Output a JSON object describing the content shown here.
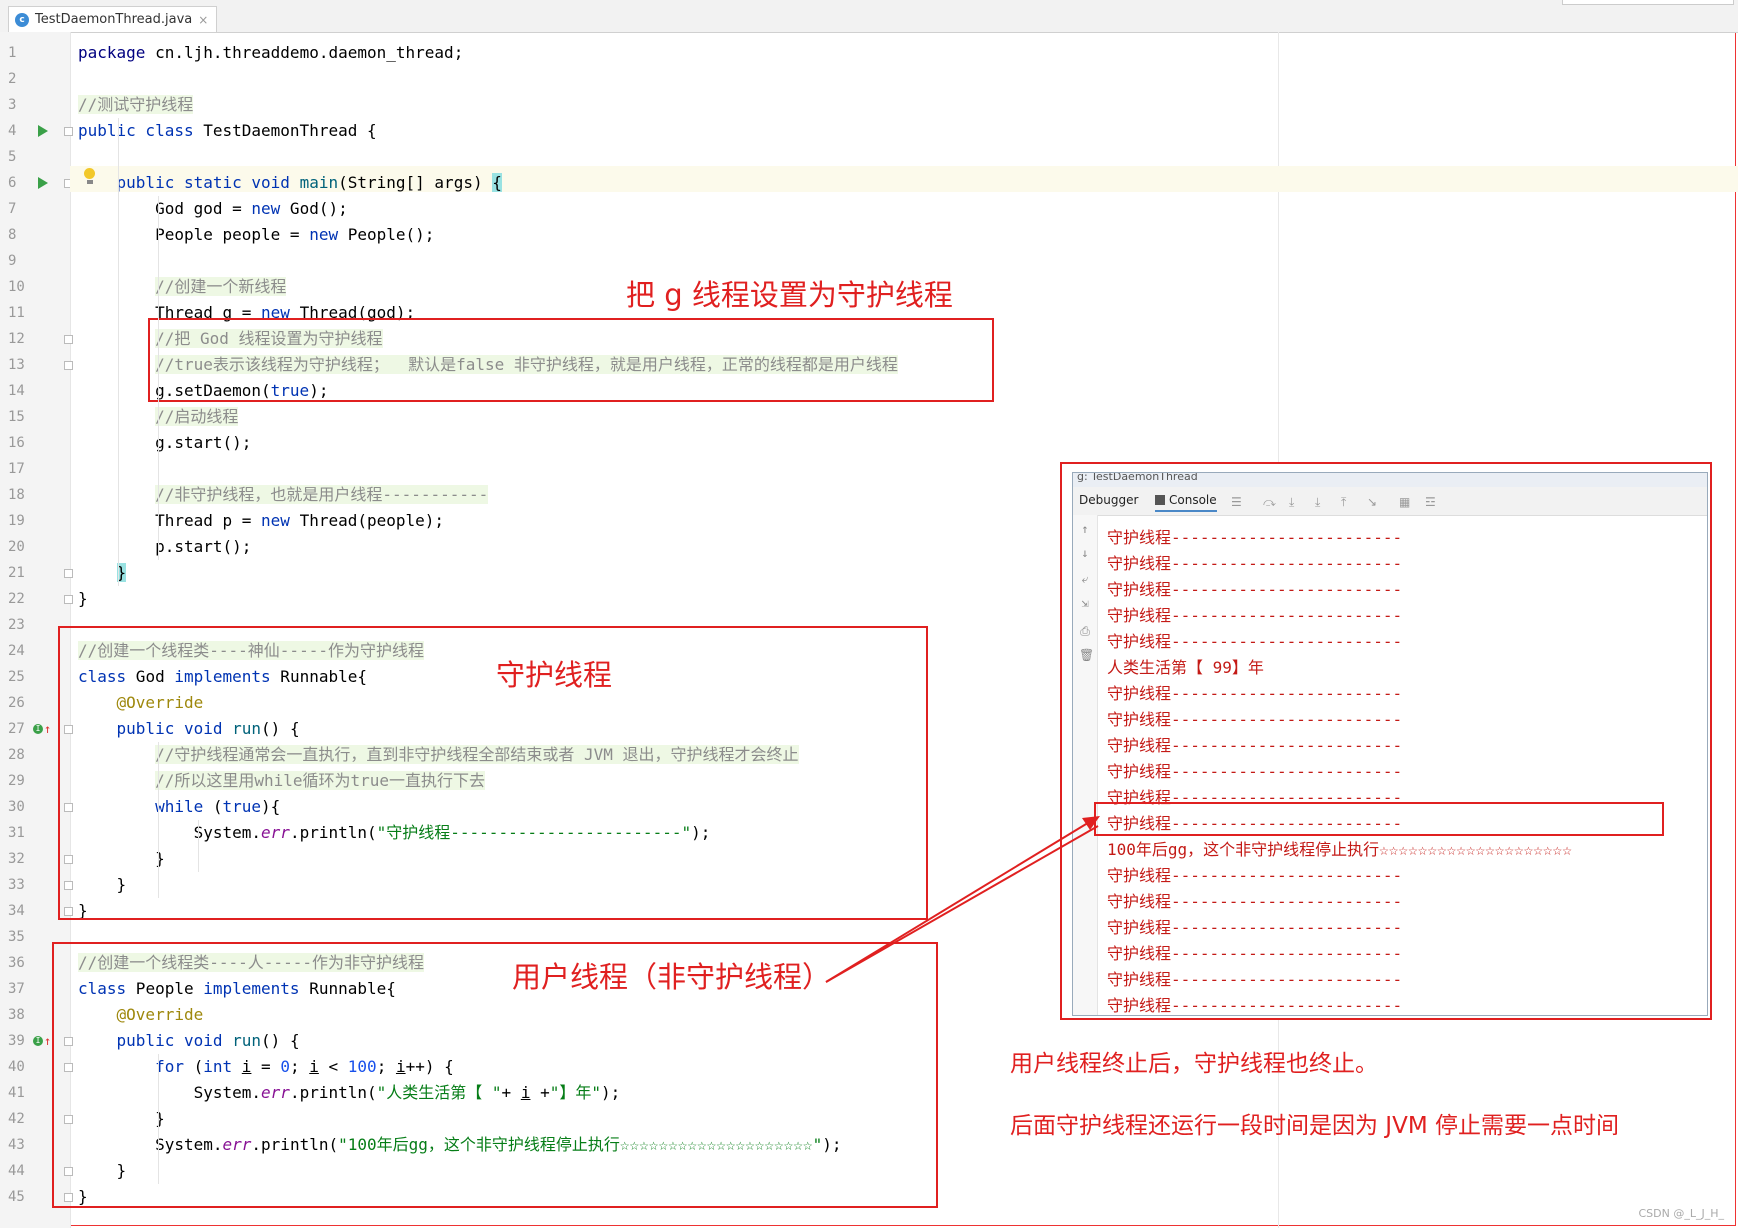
{
  "tab": {
    "filename": "TestDaemonThread.java",
    "close": "×",
    "icon_letter": "c"
  },
  "code_lines": [
    {
      "n": "1",
      "parts": [
        {
          "c": "kwo",
          "t": "package"
        },
        {
          "c": "",
          "t": " cn.ljh.threaddemo.daemon_thread;"
        }
      ]
    },
    {
      "n": "2",
      "parts": []
    },
    {
      "n": "3",
      "parts": [
        {
          "c": "cmt",
          "t": "//测试守护线程"
        }
      ]
    },
    {
      "n": "4",
      "parts": [
        {
          "c": "kw",
          "t": "public class"
        },
        {
          "c": "",
          "t": " TestDaemonThread {"
        }
      ]
    },
    {
      "n": "5",
      "parts": []
    },
    {
      "n": "6",
      "parts": [
        {
          "c": "",
          "t": "    "
        },
        {
          "c": "kw",
          "t": "public static void"
        },
        {
          "c": "",
          "t": " "
        },
        {
          "c": "fn",
          "t": "main"
        },
        {
          "c": "",
          "t": "(String[] args) "
        },
        {
          "c": "brace-hl",
          "t": "{"
        }
      ]
    },
    {
      "n": "7",
      "parts": [
        {
          "c": "",
          "t": "        God god = "
        },
        {
          "c": "kw",
          "t": "new"
        },
        {
          "c": "",
          "t": " God();"
        }
      ]
    },
    {
      "n": "8",
      "parts": [
        {
          "c": "",
          "t": "        People people = "
        },
        {
          "c": "kw",
          "t": "new"
        },
        {
          "c": "",
          "t": " People();"
        }
      ]
    },
    {
      "n": "9",
      "parts": []
    },
    {
      "n": "10",
      "parts": [
        {
          "c": "",
          "t": "        "
        },
        {
          "c": "cmt",
          "t": "//创建一个新线程"
        }
      ]
    },
    {
      "n": "11",
      "parts": [
        {
          "c": "",
          "t": "        Thread g = "
        },
        {
          "c": "kw",
          "t": "new"
        },
        {
          "c": "",
          "t": " Thread(god);"
        }
      ]
    },
    {
      "n": "12",
      "parts": [
        {
          "c": "",
          "t": "        "
        },
        {
          "c": "cmt",
          "t": "//把 God 线程设置为守护线程"
        }
      ]
    },
    {
      "n": "13",
      "parts": [
        {
          "c": "",
          "t": "        "
        },
        {
          "c": "cmt",
          "t": "//true表示该线程为守护线程；  默认是false 非守护线程，就是用户线程，正常的线程都是用户线程"
        }
      ]
    },
    {
      "n": "14",
      "parts": [
        {
          "c": "",
          "t": "        g.setDaemon("
        },
        {
          "c": "kw",
          "t": "true"
        },
        {
          "c": "",
          "t": ");"
        }
      ]
    },
    {
      "n": "15",
      "parts": [
        {
          "c": "",
          "t": "        "
        },
        {
          "c": "cmt",
          "t": "//启动线程"
        }
      ]
    },
    {
      "n": "16",
      "parts": [
        {
          "c": "",
          "t": "        g.start();"
        }
      ]
    },
    {
      "n": "17",
      "parts": []
    },
    {
      "n": "18",
      "parts": [
        {
          "c": "",
          "t": "        "
        },
        {
          "c": "cmt",
          "t": "//非守护线程，也就是用户线程-----------"
        }
      ]
    },
    {
      "n": "19",
      "parts": [
        {
          "c": "",
          "t": "        Thread p = "
        },
        {
          "c": "kw",
          "t": "new"
        },
        {
          "c": "",
          "t": " Thread(people);"
        }
      ]
    },
    {
      "n": "20",
      "parts": [
        {
          "c": "",
          "t": "        p.start();"
        }
      ]
    },
    {
      "n": "21",
      "parts": [
        {
          "c": "",
          "t": "    "
        },
        {
          "c": "brace-hl",
          "t": "}"
        }
      ]
    },
    {
      "n": "22",
      "parts": [
        {
          "c": "",
          "t": "}"
        }
      ]
    },
    {
      "n": "23",
      "parts": []
    },
    {
      "n": "24",
      "parts": [
        {
          "c": "cmt",
          "t": "//创建一个线程类----神仙-----作为守护线程"
        }
      ]
    },
    {
      "n": "25",
      "parts": [
        {
          "c": "kw",
          "t": "class"
        },
        {
          "c": "",
          "t": " God "
        },
        {
          "c": "kw",
          "t": "implements"
        },
        {
          "c": "",
          "t": " Runnable{"
        }
      ]
    },
    {
      "n": "26",
      "parts": [
        {
          "c": "",
          "t": "    "
        },
        {
          "c": "ann",
          "t": "@Override"
        }
      ]
    },
    {
      "n": "27",
      "parts": [
        {
          "c": "",
          "t": "    "
        },
        {
          "c": "kw",
          "t": "public void"
        },
        {
          "c": "",
          "t": " "
        },
        {
          "c": "fn",
          "t": "run"
        },
        {
          "c": "",
          "t": "() {"
        }
      ]
    },
    {
      "n": "28",
      "parts": [
        {
          "c": "",
          "t": "        "
        },
        {
          "c": "cmt",
          "t": "//守护线程通常会一直执行，直到非守护线程全部结束或者 JVM 退出，守护线程才会终止"
        }
      ]
    },
    {
      "n": "29",
      "parts": [
        {
          "c": "",
          "t": "        "
        },
        {
          "c": "cmt",
          "t": "//所以这里用while循环为true一直执行下去"
        }
      ]
    },
    {
      "n": "30",
      "parts": [
        {
          "c": "",
          "t": "        "
        },
        {
          "c": "kw",
          "t": "while"
        },
        {
          "c": "",
          "t": " ("
        },
        {
          "c": "kw",
          "t": "true"
        },
        {
          "c": "",
          "t": "){"
        }
      ]
    },
    {
      "n": "31",
      "parts": [
        {
          "c": "",
          "t": "            System."
        },
        {
          "c": "fld",
          "t": "err"
        },
        {
          "c": "",
          "t": ".println("
        },
        {
          "c": "str",
          "t": "\"守护线程------------------------\""
        },
        {
          "c": "",
          "t": ");"
        }
      ]
    },
    {
      "n": "32",
      "parts": [
        {
          "c": "",
          "t": "        }"
        }
      ]
    },
    {
      "n": "33",
      "parts": [
        {
          "c": "",
          "t": "    }"
        }
      ]
    },
    {
      "n": "34",
      "parts": [
        {
          "c": "",
          "t": "}"
        }
      ]
    },
    {
      "n": "35",
      "parts": []
    },
    {
      "n": "36",
      "parts": [
        {
          "c": "cmt",
          "t": "//创建一个线程类----人-----作为非守护线程"
        }
      ]
    },
    {
      "n": "37",
      "parts": [
        {
          "c": "kw",
          "t": "class"
        },
        {
          "c": "",
          "t": " People "
        },
        {
          "c": "kw",
          "t": "implements"
        },
        {
          "c": "",
          "t": " Runnable{"
        }
      ]
    },
    {
      "n": "38",
      "parts": [
        {
          "c": "",
          "t": "    "
        },
        {
          "c": "ann",
          "t": "@Override"
        }
      ]
    },
    {
      "n": "39",
      "parts": [
        {
          "c": "",
          "t": "    "
        },
        {
          "c": "kw",
          "t": "public void"
        },
        {
          "c": "",
          "t": " "
        },
        {
          "c": "fn",
          "t": "run"
        },
        {
          "c": "",
          "t": "() {"
        }
      ]
    },
    {
      "n": "40",
      "parts": [
        {
          "c": "",
          "t": "        "
        },
        {
          "c": "kw",
          "t": "for"
        },
        {
          "c": "",
          "t": " ("
        },
        {
          "c": "kw",
          "t": "int"
        },
        {
          "c": "",
          "t": " "
        },
        {
          "c": "und",
          "t": "i"
        },
        {
          "c": "",
          "t": " = "
        },
        {
          "c": "num",
          "t": "0"
        },
        {
          "c": "",
          "t": "; "
        },
        {
          "c": "und",
          "t": "i"
        },
        {
          "c": "",
          "t": " < "
        },
        {
          "c": "num",
          "t": "100"
        },
        {
          "c": "",
          "t": "; "
        },
        {
          "c": "und",
          "t": "i"
        },
        {
          "c": "",
          "t": "++) {"
        }
      ]
    },
    {
      "n": "41",
      "parts": [
        {
          "c": "",
          "t": "            System."
        },
        {
          "c": "fld",
          "t": "err"
        },
        {
          "c": "",
          "t": ".println("
        },
        {
          "c": "str",
          "t": "\"人类生活第【 \""
        },
        {
          "c": "",
          "t": "+ "
        },
        {
          "c": "und",
          "t": "i"
        },
        {
          "c": "",
          "t": " +"
        },
        {
          "c": "str",
          "t": "\"】年\""
        },
        {
          "c": "",
          "t": ");"
        }
      ]
    },
    {
      "n": "42",
      "parts": [
        {
          "c": "",
          "t": "        }"
        }
      ]
    },
    {
      "n": "43",
      "parts": [
        {
          "c": "",
          "t": "        System."
        },
        {
          "c": "fld",
          "t": "err"
        },
        {
          "c": "",
          "t": ".println("
        },
        {
          "c": "str",
          "t": "\"100年后gg，这个非守护线程停止执行☆☆☆☆☆☆☆☆☆☆☆☆☆☆☆☆☆☆☆☆\""
        },
        {
          "c": "",
          "t": ");"
        }
      ]
    },
    {
      "n": "44",
      "parts": [
        {
          "c": "",
          "t": "    }"
        }
      ]
    },
    {
      "n": "45",
      "parts": [
        {
          "c": "",
          "t": "}"
        }
      ]
    }
  ],
  "notes": {
    "daemon_setting": "把 g 线程设置为守护线程",
    "daemon_thread": "守护线程",
    "user_thread": "用户线程（非守护线程）",
    "conclusion_1": "用户线程终止后，守护线程也终止。",
    "conclusion_2": "后面守护线程还运行一段时间是因为 JVM 停止需要一点时间"
  },
  "console": {
    "title_partial": "g:   TestDaemonThread",
    "tab_debugger": "Debugger",
    "tab_console": "Console",
    "lines": [
      "守护线程------------------------",
      "守护线程------------------------",
      "守护线程------------------------",
      "守护线程------------------------",
      "守护线程------------------------",
      "人类生活第【 99】年",
      "守护线程------------------------",
      "守护线程------------------------",
      "守护线程------------------------",
      "守护线程------------------------",
      "守护线程------------------------",
      "守护线程------------------------",
      "100年后gg，这个非守护线程停止执行☆☆☆☆☆☆☆☆☆☆☆☆☆☆☆☆☆☆☆☆",
      "守护线程------------------------",
      "守护线程------------------------",
      "守护线程------------------------",
      "守护线程------------------------",
      "守护线程------------------------",
      "守护线程------------------------",
      "守护线程------------------------"
    ]
  },
  "watermark": "CSDN @_L_J_H_",
  "colors": {
    "annotation_red": "#e02020",
    "console_text": "#c41a16",
    "keyword": "#0033b3",
    "string": "#067d17"
  }
}
